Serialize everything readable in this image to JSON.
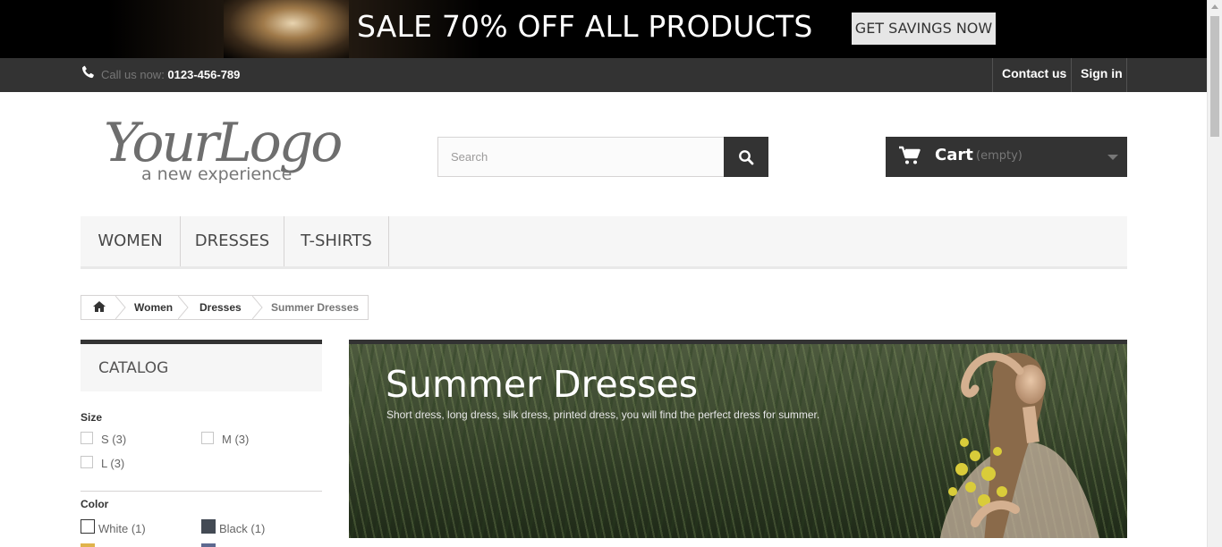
{
  "promo": {
    "headline": "SALE 70% OFF ALL PRODUCTS",
    "cta_label": "GET SAVINGS NOW"
  },
  "topbar": {
    "call_prefix": "Call us now: ",
    "phone": "0123-456-789",
    "contact_label": "Contact us",
    "signin_label": "Sign in"
  },
  "header": {
    "logo_word": "YourLogo",
    "logo_tagline": "a new experience",
    "search_placeholder": "Search",
    "cart_label": "Cart",
    "cart_status": "(empty)"
  },
  "menu": {
    "items": [
      {
        "label": "WOMEN"
      },
      {
        "label": "DRESSES"
      },
      {
        "label": "T-SHIRTS"
      }
    ]
  },
  "breadcrumb": {
    "items": [
      "Women",
      "Dresses"
    ],
    "current": "Summer Dresses"
  },
  "sidebar": {
    "title": "CATALOG",
    "size_title": "Size",
    "sizes": [
      "S (3)",
      "M (3)",
      "L (3)"
    ],
    "color_title": "Color",
    "colors": [
      {
        "label": "White (1)",
        "swatch": "#ffffff"
      },
      {
        "label": "Black (1)",
        "swatch": "#434a54"
      }
    ]
  },
  "category": {
    "title": "Summer Dresses",
    "description": "Short dress, long dress, silk dress, printed dress, you will find the perfect dress for summer."
  },
  "colors": {
    "dark": "#333333",
    "promo_bg": "#000000",
    "menu_bg": "#f6f6f6"
  }
}
